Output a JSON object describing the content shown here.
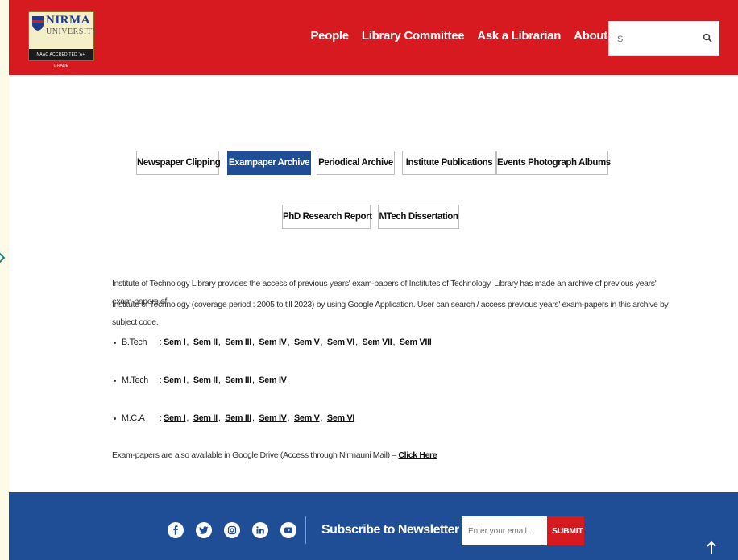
{
  "header": {
    "logo": {
      "name": "NIRMA",
      "sub": "UNIVERSITY",
      "accreditation": "NAAC ACCREDITED 'A+' GRADE"
    },
    "nav": [
      "People",
      "Library Committee",
      "Ask a Librarian",
      "About"
    ],
    "search": {
      "value": "S",
      "placeholder": "S"
    }
  },
  "tabs": {
    "row1": [
      "Newspaper Clipping",
      "Exampaper Archive",
      "Periodical Archive",
      "Institute Publications",
      "Events Photograph Albums"
    ],
    "row2": [
      "PhD Research Report",
      "MTech Dissertation"
    ],
    "active": "Exampaper Archive"
  },
  "content": {
    "description_line1": "Institute of Technology Library provides the access of previous years' exam-papers of Institutes of Technology.  Library has made an archive of previous years' exam-papers of",
    "description_line2": "Institute of Technology (coverage period : 2005 to till 2023) by using Google Application. User can search / access previous years' exam-papers in this archive by subject code.",
    "programs": [
      {
        "name": "B.Tech",
        "sems": [
          "Sem I",
          "Sem II",
          "Sem III",
          "Sem IV",
          "Sem V",
          "Sem VI",
          "Sem VII",
          "Sem VIII"
        ]
      },
      {
        "name": "M.Tech",
        "sems": [
          "Sem I",
          "Sem II",
          "Sem III",
          "Sem IV"
        ]
      },
      {
        "name": "M.C.A",
        "sems": [
          "Sem I",
          "Sem II",
          "Sem III",
          "Sem IV",
          "Sem V",
          "Sem VI"
        ]
      }
    ],
    "drive_note": "Exam-papers are also available in Google Drive (Access through Nirmauni Mail) – ",
    "drive_link": "Click Here"
  },
  "footer": {
    "social_icons": [
      "facebook-icon",
      "twitter-icon",
      "instagram-icon",
      "linkedin-icon",
      "youtube-icon"
    ],
    "subscribe_title": "Subscribe to Newsletter",
    "email_placeholder": "Enter your email...",
    "submit_label": "SUBMIT"
  },
  "colors": {
    "brand_red": "#d71920",
    "brand_blue": "#1f4e96"
  }
}
